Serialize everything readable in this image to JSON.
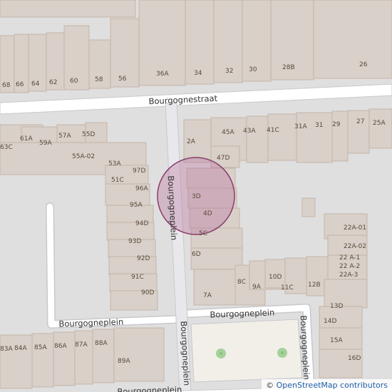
{
  "colors": {
    "background": "#e0dfdf",
    "building": "#d8d0c9",
    "building_stroke": "#c4b5a8",
    "road": "#ffffff",
    "road_casing": "#c8c8cc",
    "footway": "#ffffff",
    "park": "#f2efe9",
    "tree": "#a5d19a",
    "highlight_fill": "#b76e9a",
    "highlight_stroke": "#8a3b6b"
  },
  "streets": [
    {
      "id": "bourgognestraat",
      "name": "Bourgognestraat"
    },
    {
      "id": "bourgogneplein-vertical",
      "name": "Bourgogneplein"
    },
    {
      "id": "bourgogneplein-horizontal-left",
      "name": "Bourgogneplein"
    },
    {
      "id": "bourgogneplein-horizontal-right",
      "name": "Bourgogneplein"
    },
    {
      "id": "bourgogneplein-south",
      "name": "Bourgogneplein"
    },
    {
      "id": "bourgogneplein-east",
      "name": "Bourgogneplein"
    },
    {
      "id": "bourgogneplein-bottom",
      "name": "Bourgogneplein"
    }
  ],
  "house_numbers": [
    "68",
    "66",
    "64",
    "62",
    "60",
    "58",
    "56",
    "36A",
    "34",
    "32",
    "30",
    "28B",
    "26",
    "61A",
    "59A",
    "57A",
    "55D",
    "63C",
    "55A-02",
    "53A",
    "97D",
    "51C",
    "96A",
    "95A",
    "94D",
    "93D",
    "92D",
    "91C",
    "90D",
    "2A",
    "45A",
    "43A",
    "41C",
    "31A",
    "31",
    "29",
    "27",
    "25A",
    "47D",
    "3D",
    "4D",
    "5C",
    "6D",
    "8C",
    "9A",
    "10D",
    "11C",
    "12B",
    "7A",
    "22A-01",
    "22A-02",
    "22 A-1",
    "22 A-2",
    "22A-3",
    "13D",
    "14D",
    "15A",
    "16D",
    "83A",
    "84A",
    "85A",
    "86A",
    "87A",
    "88A",
    "89A"
  ],
  "attribution": {
    "copy": "© ",
    "link": "OpenStreetMap contributors"
  }
}
